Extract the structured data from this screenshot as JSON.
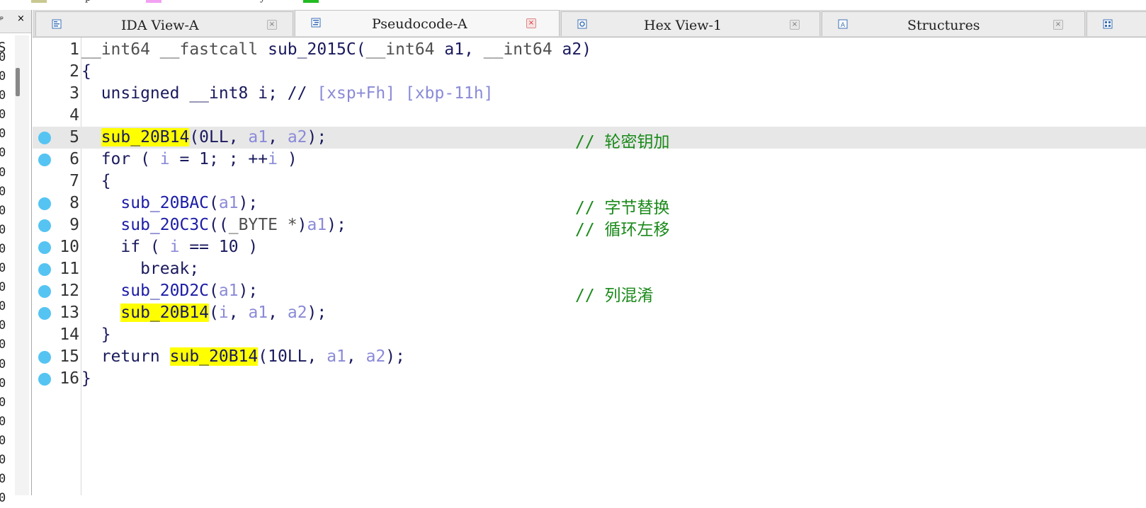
{
  "top_strip": {
    "swatches": [
      "#c8c890",
      "#f2a0f2",
      "#22bb22"
    ],
    "fragments": [
      "p",
      "y"
    ]
  },
  "left_panel": {
    "pin_glyph": "ᵖ",
    "close_glyph": "×",
    "column_letter": "S",
    "column_chars": [
      "0",
      "0",
      "0",
      "0",
      "0",
      "0",
      "0",
      "0",
      "0",
      "0",
      "0",
      "0",
      "0",
      "0",
      "0",
      "0",
      "0",
      "0",
      "0",
      "0",
      "0",
      "0",
      "0",
      "0"
    ]
  },
  "tabs": [
    {
      "label": "IDA View-A",
      "icon": "ida-view-icon",
      "active": false
    },
    {
      "label": "Pseudocode-A",
      "icon": "pseudocode-icon",
      "active": true
    },
    {
      "label": "Hex View-1",
      "icon": "hex-view-icon",
      "active": false
    },
    {
      "label": "Structures",
      "icon": "structures-icon",
      "active": false
    }
  ],
  "code": {
    "highlighted_line": 5,
    "lines": [
      {
        "num": "1",
        "dot": false,
        "tokens": [
          [
            "type",
            "__int64 __fastcall "
          ],
          [
            "plain",
            "sub_2015C("
          ],
          [
            "type",
            "__int64 "
          ],
          [
            "plain",
            "a1, "
          ],
          [
            "type",
            "__int64 "
          ],
          [
            "plain",
            "a2)"
          ]
        ],
        "comment": ""
      },
      {
        "num": "2",
        "dot": false,
        "tokens": [
          [
            "plain",
            "{"
          ]
        ],
        "comment": ""
      },
      {
        "num": "3",
        "dot": false,
        "tokens": [
          [
            "plain",
            "  unsigned __int8 i; // "
          ],
          [
            "stackcmt",
            "[xsp+Fh] [xbp-11h]"
          ]
        ],
        "comment": ""
      },
      {
        "num": "4",
        "dot": false,
        "tokens": [],
        "comment": ""
      },
      {
        "num": "5",
        "dot": true,
        "tokens": [
          [
            "plain",
            "  "
          ],
          [
            "hl",
            "sub_20B14"
          ],
          [
            "plain",
            "(0LL, "
          ],
          [
            "var",
            "a1"
          ],
          [
            "plain",
            ", "
          ],
          [
            "var",
            "a2"
          ],
          [
            "plain",
            ");"
          ]
        ],
        "comment": "// 轮密钥加"
      },
      {
        "num": "6",
        "dot": true,
        "tokens": [
          [
            "plain",
            "  for ( "
          ],
          [
            "var",
            "i"
          ],
          [
            "plain",
            " = 1; ; ++"
          ],
          [
            "var",
            "i"
          ],
          [
            "plain",
            " )"
          ]
        ],
        "comment": ""
      },
      {
        "num": "7",
        "dot": false,
        "tokens": [
          [
            "plain",
            "  {"
          ]
        ],
        "comment": ""
      },
      {
        "num": "8",
        "dot": true,
        "tokens": [
          [
            "plain",
            "    "
          ],
          [
            "fn",
            "sub_20BAC"
          ],
          [
            "plain",
            "("
          ],
          [
            "var",
            "a1"
          ],
          [
            "plain",
            ");"
          ]
        ],
        "comment": "// 字节替换"
      },
      {
        "num": "9",
        "dot": true,
        "tokens": [
          [
            "plain",
            "    "
          ],
          [
            "fn",
            "sub_20C3C"
          ],
          [
            "plain",
            "(("
          ],
          [
            "bytetype",
            "_BYTE *"
          ],
          [
            "plain",
            ")"
          ],
          [
            "var",
            "a1"
          ],
          [
            "plain",
            ");"
          ]
        ],
        "comment": "// 循环左移"
      },
      {
        "num": "10",
        "dot": true,
        "tokens": [
          [
            "plain",
            "    if ( "
          ],
          [
            "var",
            "i"
          ],
          [
            "plain",
            " == 10 )"
          ]
        ],
        "comment": ""
      },
      {
        "num": "11",
        "dot": true,
        "tokens": [
          [
            "plain",
            "      break;"
          ]
        ],
        "comment": ""
      },
      {
        "num": "12",
        "dot": true,
        "tokens": [
          [
            "plain",
            "    "
          ],
          [
            "fn",
            "sub_20D2C"
          ],
          [
            "plain",
            "("
          ],
          [
            "var",
            "a1"
          ],
          [
            "plain",
            ");"
          ]
        ],
        "comment": "// 列混淆"
      },
      {
        "num": "13",
        "dot": true,
        "tokens": [
          [
            "plain",
            "    "
          ],
          [
            "hl",
            "sub_20B14"
          ],
          [
            "plain",
            "("
          ],
          [
            "var",
            "i"
          ],
          [
            "plain",
            ", "
          ],
          [
            "var",
            "a1"
          ],
          [
            "plain",
            ", "
          ],
          [
            "var",
            "a2"
          ],
          [
            "plain",
            ");"
          ]
        ],
        "comment": ""
      },
      {
        "num": "14",
        "dot": false,
        "tokens": [
          [
            "plain",
            "  }"
          ]
        ],
        "comment": ""
      },
      {
        "num": "15",
        "dot": true,
        "tokens": [
          [
            "plain",
            "  return "
          ],
          [
            "hl",
            "sub_20B14"
          ],
          [
            "plain",
            "(10LL, "
          ],
          [
            "var",
            "a1"
          ],
          [
            "plain",
            ", "
          ],
          [
            "var",
            "a2"
          ],
          [
            "plain",
            ");"
          ]
        ],
        "comment": ""
      },
      {
        "num": "16",
        "dot": true,
        "tokens": [
          [
            "plain",
            "}"
          ]
        ],
        "comment": ""
      }
    ]
  },
  "colors": {
    "highlight": "#ffff00",
    "breakpoint_dot": "#55c4f2",
    "comment": "#1a8a1a",
    "variable": "#8a8ad8",
    "active_tab_close": "#e03030"
  }
}
